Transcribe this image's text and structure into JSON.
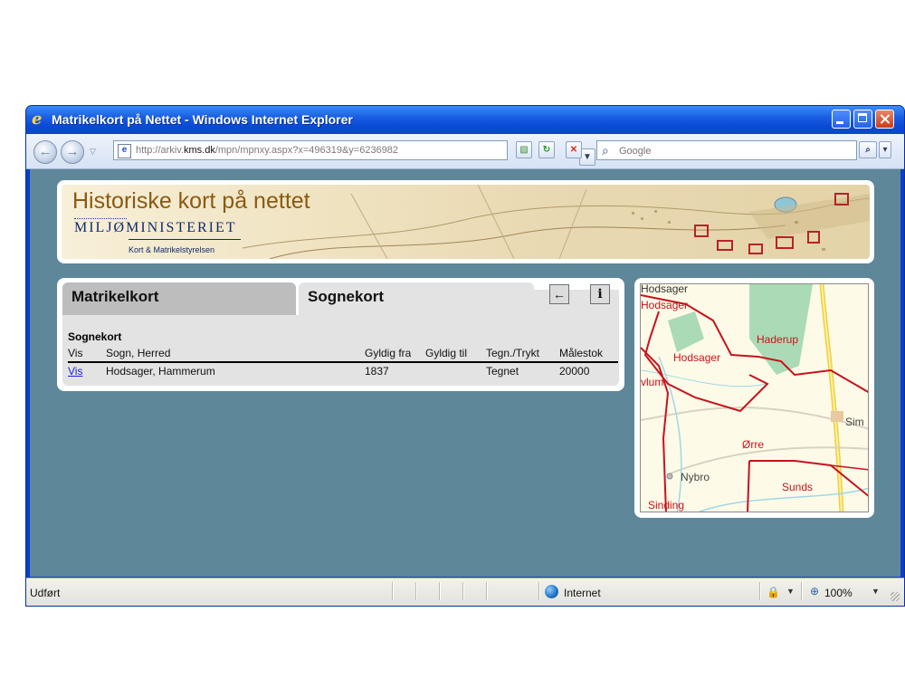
{
  "window": {
    "title": "Matrikelkort på Nettet - Windows Internet Explorer"
  },
  "toolbar": {
    "address_url_host_prefix": "http://arkiv.",
    "address_url_host": "kms.dk",
    "address_url_rest": "/mpn/mpnxy.aspx?x=496319&y=6236982",
    "search_placeholder": "Google"
  },
  "banner": {
    "title": "Historiske kort på nettet",
    "ministry": "MILJØMINISTERIET",
    "agency": "Kort & Matrikelstyrelsen"
  },
  "tabs": {
    "matrikel": "Matrikelkort",
    "sogne": "Sognekort"
  },
  "table": {
    "section_title": "Sognekort",
    "headers": [
      "Vis",
      "Sogn, Herred",
      "Gyldig fra",
      "Gyldig til",
      "Tegn./Trykt",
      "Målestok"
    ],
    "rows": [
      {
        "vis": "Vis",
        "sogn": "Hodsager, Hammerum",
        "gyldig_fra": "1837",
        "gyldig_til": "",
        "tegn": "Tegnet",
        "malestok": "20000"
      }
    ]
  },
  "map": {
    "labels": [
      "Hodsager",
      "Hodsager",
      "Haderup",
      "Hodsager",
      "vlum",
      "Sim",
      "Ørre",
      "Nybro",
      "Sunds",
      "Sinding"
    ]
  },
  "statusbar": {
    "status": "Udført",
    "zone": "Internet",
    "zoom": "100%"
  },
  "colors": {
    "page_background": "#5e8799",
    "title_bar": "#0a4bd6",
    "link": "#1f1fdc",
    "map_boundary": "#c8121c"
  }
}
